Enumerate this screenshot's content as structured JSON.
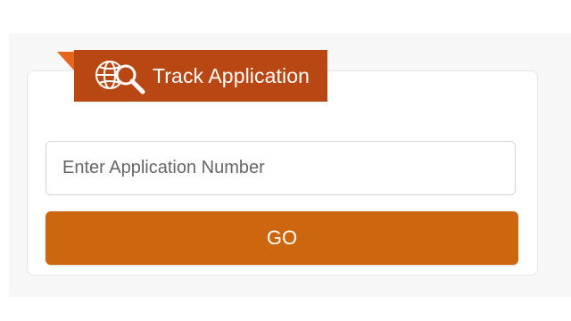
{
  "widget": {
    "title": "Track Application",
    "icon": "globe-search-icon",
    "input": {
      "placeholder": "Enter Application Number",
      "value": ""
    },
    "go_label": "GO"
  },
  "colors": {
    "ribbon": "#b84713",
    "ribbon_fold": "#e5651f",
    "button": "#cd670f"
  }
}
